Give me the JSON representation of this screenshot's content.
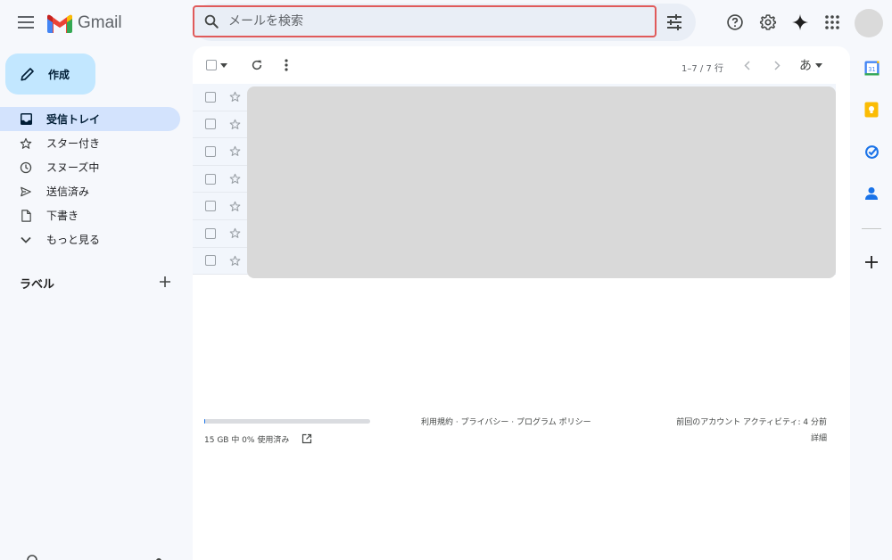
{
  "header": {
    "logo_text": "Gmail",
    "search_placeholder": "メールを検索"
  },
  "compose": {
    "label": "作成"
  },
  "nav": {
    "items": [
      {
        "label": "受信トレイ",
        "icon": "inbox-icon",
        "active": true
      },
      {
        "label": "スター付き",
        "icon": "star-icon"
      },
      {
        "label": "スヌーズ中",
        "icon": "clock-icon"
      },
      {
        "label": "送信済み",
        "icon": "send-icon"
      },
      {
        "label": "下書き",
        "icon": "draft-icon"
      },
      {
        "label": "もっと見る",
        "icon": "chevron-down-icon"
      }
    ],
    "labels_title": "ラベル"
  },
  "toolbar": {
    "pager": "1–7 / 7 行",
    "input_tool": "あ"
  },
  "inbox": {
    "row_count": 7
  },
  "footer": {
    "storage": "15 GB 中 0% 使用済み",
    "storage_used_fraction": 0,
    "policy": "利用規約 · プライバシー · プログラム ポリシー",
    "last_activity": "前回のアカウント アクティビティ: 4 分前",
    "details": "詳細"
  },
  "colors": {
    "accent": "#1a73e8",
    "compose_bg": "#c2e7ff",
    "active_nav_bg": "#d3e3fd",
    "search_highlight": "#e05a5a"
  }
}
